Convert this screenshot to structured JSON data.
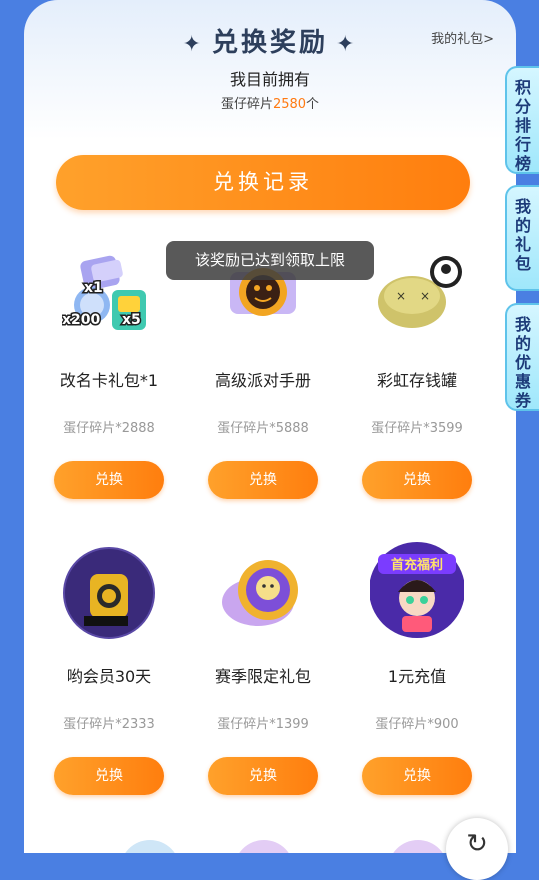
{
  "header": {
    "title": "兑换奖励",
    "my_gift": "我的礼包>"
  },
  "own": {
    "line1": "我目前拥有",
    "prefix": "蛋仔碎片",
    "count": "2580",
    "suffix": "个"
  },
  "record_button": "兑换记录",
  "toast": "该奖励已达到领取上限",
  "items": [
    {
      "name": "改名卡礼包*1",
      "cost": "蛋仔碎片*2888",
      "button": "兑换",
      "badges": [
        "x1",
        "x200",
        "x5"
      ]
    },
    {
      "name": "高级派对手册",
      "cost": "蛋仔碎片*5888",
      "button": "兑换"
    },
    {
      "name": "彩虹存钱罐",
      "cost": "蛋仔碎片*3599",
      "button": "兑换"
    },
    {
      "name": "哟会员30天",
      "cost": "蛋仔碎片*2333",
      "button": "兑换"
    },
    {
      "name": "赛季限定礼包",
      "cost": "蛋仔碎片*1399",
      "button": "兑换"
    },
    {
      "name": "1元充值",
      "cost": "蛋仔碎片*900",
      "button": "兑换",
      "banner": "首充福利"
    }
  ],
  "side_tabs": [
    "积分排行榜",
    "我的礼包",
    "我的优惠券"
  ],
  "icons": {
    "star": "sparkle-icon",
    "refresh": "refresh-icon"
  },
  "colors": {
    "accent": "#ff8a1a",
    "background": "#4a7fe2",
    "count": "#ff7a12"
  }
}
